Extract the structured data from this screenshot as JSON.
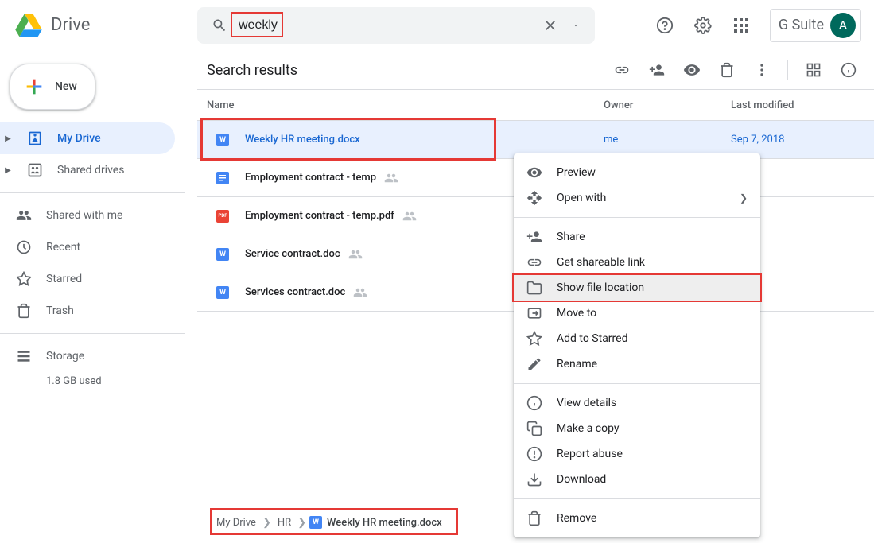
{
  "header": {
    "app_name": "Drive",
    "search_value": "weekly",
    "gsuite_label": "G Suite",
    "avatar_letter": "A"
  },
  "sidebar": {
    "new_label": "New",
    "items": [
      {
        "label": "My Drive",
        "icon": "my-drive",
        "expandable": true,
        "active": true
      },
      {
        "label": "Shared drives",
        "icon": "shared-drives",
        "expandable": true,
        "active": false
      }
    ],
    "items2": [
      {
        "label": "Shared with me",
        "icon": "shared-with-me"
      },
      {
        "label": "Recent",
        "icon": "recent"
      },
      {
        "label": "Starred",
        "icon": "starred"
      },
      {
        "label": "Trash",
        "icon": "trash"
      }
    ],
    "storage_label": "Storage",
    "storage_used": "1.8 GB used"
  },
  "main": {
    "title": "Search results",
    "columns": {
      "name": "Name",
      "owner": "Owner",
      "modified": "Last modified"
    },
    "rows": [
      {
        "name": "Weekly HR meeting.docx",
        "type": "docx",
        "owner": "me",
        "modified": "Sep 7, 2018",
        "shared": false,
        "selected": true,
        "highlighted": true
      },
      {
        "name": "Employment contract - temp",
        "type": "gdoc",
        "owner": "",
        "modified": "",
        "shared": true
      },
      {
        "name": "Employment contract - temp.pdf",
        "type": "pdf",
        "owner": "",
        "modified": "",
        "shared": true
      },
      {
        "name": "Service contract.doc",
        "type": "docx",
        "owner": "",
        "modified": "",
        "shared": true
      },
      {
        "name": "Services contract.doc",
        "type": "docx",
        "owner": "",
        "modified": "",
        "shared": true
      }
    ]
  },
  "context_menu": {
    "items": [
      {
        "label": "Preview",
        "icon": "eye"
      },
      {
        "label": "Open with",
        "icon": "open-with",
        "submenu": true
      },
      {
        "divider": true
      },
      {
        "label": "Share",
        "icon": "person-add"
      },
      {
        "label": "Get shareable link",
        "icon": "link"
      },
      {
        "label": "Show file location",
        "icon": "folder",
        "highlighted": true
      },
      {
        "label": "Move to",
        "icon": "move"
      },
      {
        "label": "Add to Starred",
        "icon": "star"
      },
      {
        "label": "Rename",
        "icon": "rename"
      },
      {
        "divider": true
      },
      {
        "label": "View details",
        "icon": "info"
      },
      {
        "label": "Make a copy",
        "icon": "copy"
      },
      {
        "label": "Report abuse",
        "icon": "report"
      },
      {
        "label": "Download",
        "icon": "download"
      },
      {
        "divider": true
      },
      {
        "label": "Remove",
        "icon": "trash"
      }
    ]
  },
  "breadcrumb": {
    "parts": [
      "My Drive",
      "HR",
      "Weekly HR meeting.docx"
    ]
  }
}
